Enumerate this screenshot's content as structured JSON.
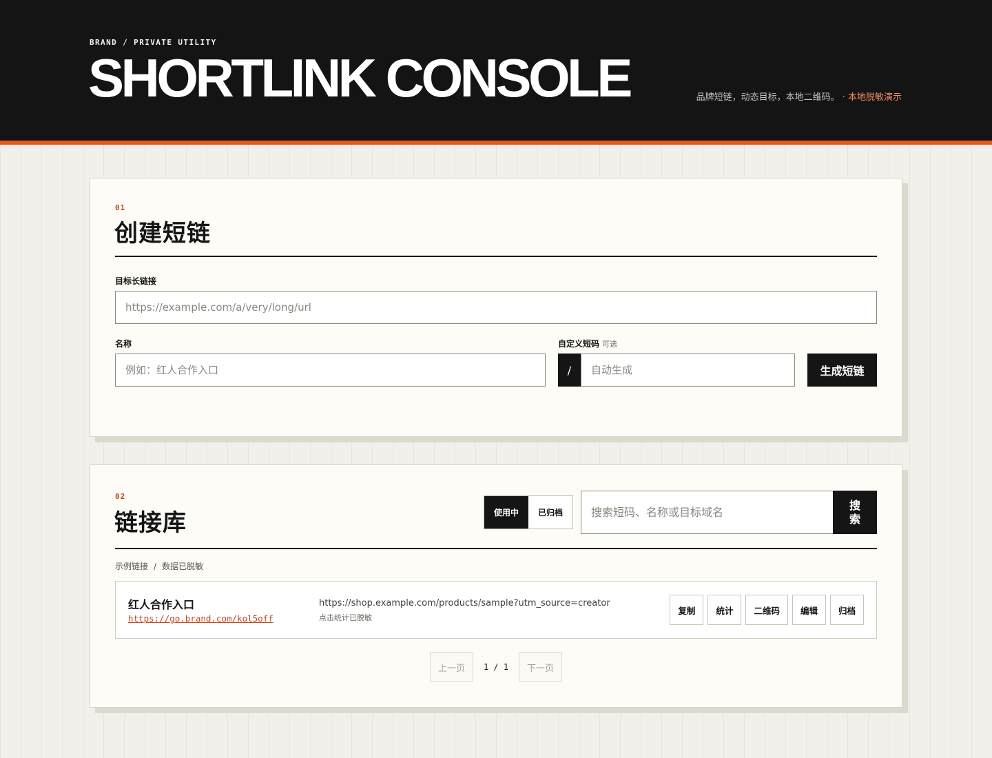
{
  "header": {
    "eyebrow": "BRAND / PRIVATE UTILITY",
    "title": "SHORTLINK CONSOLE",
    "tagline": "品牌短链，动态目标，本地二维码。",
    "tagline_note": "· 本地脱敏演示"
  },
  "create": {
    "number": "01",
    "title": "创建短链",
    "url_label": "目标长链接",
    "url_placeholder": "https://example.com/a/very/long/url",
    "name_label": "名称",
    "name_placeholder": "例如：红人合作入口",
    "code_label": "自定义短码",
    "code_hint": "可选",
    "code_prefix": "/",
    "code_placeholder": "自动生成",
    "submit_label": "生成短链"
  },
  "library": {
    "number": "02",
    "title": "链接库",
    "tabs": [
      {
        "label": "使用中",
        "active": true
      },
      {
        "label": "已归档",
        "active": false
      }
    ],
    "search_placeholder": "搜索短码、名称或目标域名",
    "search_button": "搜索",
    "meta": [
      "示例链接",
      "/",
      "数据已脱敏"
    ],
    "links": [
      {
        "name": "红人合作入口",
        "short_url": "https://go.brand.com/kol5off",
        "target": "https://shop.example.com/products/sample?utm_source=creator",
        "note": "点击统计已脱敏",
        "actions": [
          "复制",
          "统计",
          "二维码",
          "编辑",
          "归档"
        ]
      }
    ],
    "pagination": {
      "prev": "上一页",
      "info": "1 / 1",
      "next": "下一页"
    }
  },
  "colors": {
    "header_bg": "#141414",
    "accent": "#e8561c",
    "link": "#c0461b",
    "page_bg": "#f2f0ea",
    "panel_bg": "#fdfcf6"
  }
}
